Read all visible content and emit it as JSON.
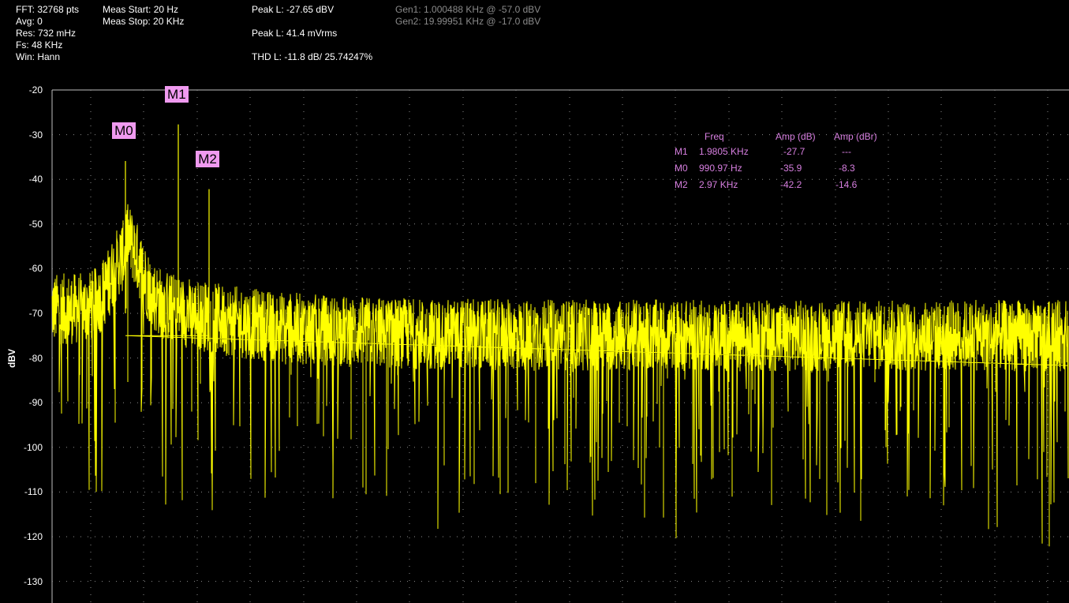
{
  "info": {
    "fft": "FFT: 32768 pts",
    "avg": "Avg: 0",
    "res": "Res: 732 mHz",
    "fs": "Fs: 48 KHz",
    "win": "Win: Hann",
    "meas_start": "Meas Start: 20 Hz",
    "meas_stop": "Meas Stop: 20 KHz",
    "peak_dbv": "Peak L: -27.65 dBV",
    "peak_mvrms": "Peak L: 41.4 mVrms",
    "thd": "THD L: -11.8 dB/ 25.74247%",
    "gen1": "Gen1: 1.000488 KHz @ -57.0 dBV",
    "gen2": "Gen2: 19.99951 KHz @ -17.0 dBV"
  },
  "chart_data": {
    "type": "line",
    "ylabel": "dBV",
    "ylim": [
      -133,
      -20
    ],
    "yticks": [
      -20,
      -30,
      -40,
      -50,
      -60,
      -70,
      -80,
      -90,
      -100,
      -110,
      -120,
      -130
    ],
    "ytick_labels": [
      "-20",
      "-30",
      "-40",
      "-50",
      "-60",
      "-70",
      "-80",
      "-90",
      "-100",
      "-110",
      "-120",
      "-130"
    ],
    "xlim_hz": [
      20,
      20000
    ],
    "grid": true,
    "series_color": "#ffff00",
    "noise_floor_dbv": -75,
    "peaks": [
      {
        "freq_hz": 990.97,
        "dbv": -35.9
      },
      {
        "freq_hz": 1980.5,
        "dbv": -27.7
      },
      {
        "freq_hz": 2970,
        "dbv": -42.2
      }
    ],
    "markers": [
      {
        "label": "M0",
        "freq_hz": 990.97,
        "dbv": -35.9
      },
      {
        "label": "M1",
        "freq_hz": 1980.5,
        "dbv": -27.7
      },
      {
        "label": "M2",
        "freq_hz": 2970,
        "dbv": -42.2
      }
    ]
  },
  "marker_table": {
    "headers": [
      "Freq",
      "Amp (dB)",
      "Amp (dBr)"
    ],
    "rows": [
      {
        "name": "M1",
        "freq": "1.9805 KHz",
        "amp_db": "-27.7",
        "amp_dbr": "---"
      },
      {
        "name": "M0",
        "freq": "990.97 Hz",
        "amp_db": "-35.9",
        "amp_dbr": "-8.3"
      },
      {
        "name": "M2",
        "freq": "2.97 KHz",
        "amp_db": "-42.2",
        "amp_dbr": "-14.6"
      }
    ]
  },
  "colors": {
    "background": "#000000",
    "trace": "#ffff00",
    "marker_bg": "#f09af0",
    "table_text": "#d77fe0",
    "grid": "#8c8c8c"
  }
}
